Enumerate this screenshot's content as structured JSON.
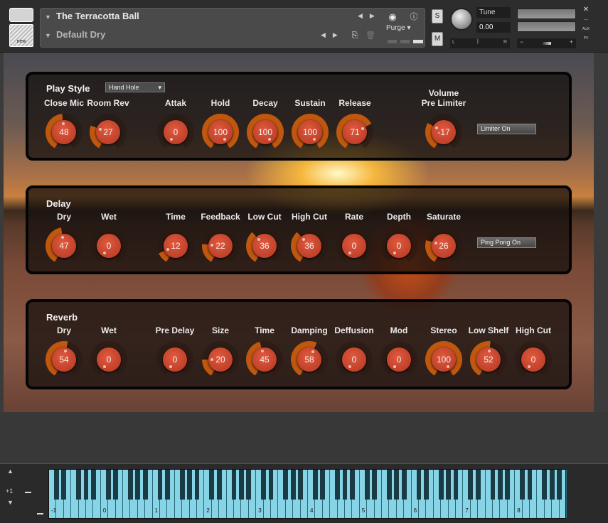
{
  "header": {
    "instrument_name": "The Terracotta Ball",
    "snapshot_name": "Default Dry",
    "purge_label": "Purge",
    "solo_label": "S",
    "mute_label": "M",
    "tune_label": "Tune",
    "tune_value": "0.00",
    "pan_left": "L",
    "pan_right": "R",
    "vol_minus": "−",
    "vol_plus": "+",
    "new_label": "new",
    "aux_label": "AUX",
    "pv_label": "PV"
  },
  "play_style": {
    "title": "Play Style",
    "dropdown": "Hand Hole",
    "limiter_button": "Limiter On",
    "knobs": [
      {
        "label": "Close Mic",
        "value": "48",
        "fill": 0.48
      },
      {
        "label": "Room Rev",
        "value": "27",
        "fill": 0.27
      },
      {
        "label": "Attak",
        "value": "0",
        "fill": 0
      },
      {
        "label": "Hold",
        "value": "100",
        "fill": 1
      },
      {
        "label": "Decay",
        "value": "100",
        "fill": 1
      },
      {
        "label": "Sustain",
        "value": "100",
        "fill": 1
      },
      {
        "label": "Release",
        "value": "71",
        "fill": 0.71
      },
      {
        "label": "Volume\nPre Limiter",
        "value": "-17",
        "fill": 0.3
      }
    ]
  },
  "delay": {
    "title": "Delay",
    "pingpong_button": "Ping Pong On",
    "knobs": [
      {
        "label": "Dry",
        "value": "47",
        "fill": 0.47
      },
      {
        "label": "Wet",
        "value": "0",
        "fill": 0
      },
      {
        "label": "Time",
        "value": "12",
        "fill": 0.12
      },
      {
        "label": "Feedback",
        "value": "22",
        "fill": 0.22
      },
      {
        "label": "Low Cut",
        "value": "36",
        "fill": 0.36
      },
      {
        "label": "High Cut",
        "value": "36",
        "fill": 0.36
      },
      {
        "label": "Rate",
        "value": "0",
        "fill": 0
      },
      {
        "label": "Depth",
        "value": "0",
        "fill": 0
      },
      {
        "label": "Saturate",
        "value": "26",
        "fill": 0.26
      }
    ]
  },
  "reverb": {
    "title": "Reverb",
    "knobs": [
      {
        "label": "Dry",
        "value": "54",
        "fill": 0.54
      },
      {
        "label": "Wet",
        "value": "0",
        "fill": 0
      },
      {
        "label": "Pre Delay",
        "value": "0",
        "fill": 0
      },
      {
        "label": "Size",
        "value": "20",
        "fill": 0.2
      },
      {
        "label": "Time",
        "value": "45",
        "fill": 0.45
      },
      {
        "label": "Damping",
        "value": "58",
        "fill": 0.58
      },
      {
        "label": "Deffusion",
        "value": "0",
        "fill": 0
      },
      {
        "label": "Mod",
        "value": "0",
        "fill": 0
      },
      {
        "label": "Stereo",
        "value": "100",
        "fill": 1
      },
      {
        "label": "Low Shelf",
        "value": "52",
        "fill": 0.52
      },
      {
        "label": "High Cut",
        "value": "0",
        "fill": 0
      }
    ]
  },
  "keyboard": {
    "octave_offset": "+1",
    "octave_labels": [
      "-1",
      "0",
      "1",
      "2",
      "3",
      "4",
      "5",
      "6",
      "7",
      "8"
    ]
  },
  "colors": {
    "knob_body": "#c8442c",
    "knob_arc": "#c0570f",
    "panel_border": "#050505"
  }
}
